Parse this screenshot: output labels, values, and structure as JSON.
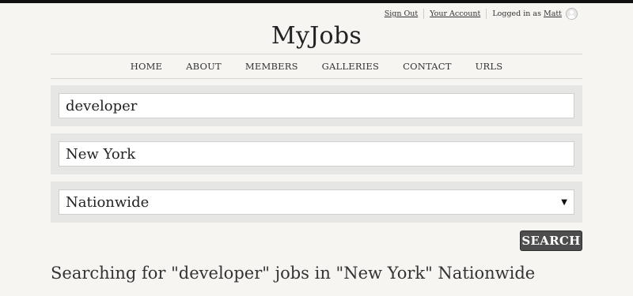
{
  "account": {
    "sign_out": "Sign Out",
    "your_account": "Your Account",
    "logged_in_prefix": "Logged in as",
    "username": "Matt"
  },
  "site": {
    "title": "MyJobs"
  },
  "nav": {
    "items": [
      "HOME",
      "ABOUT",
      "MEMBERS",
      "GALLERIES",
      "CONTACT",
      "URLS"
    ]
  },
  "search": {
    "keyword_value": "developer",
    "location_value": "New York",
    "scope_selected": "Nationwide",
    "button_label": "SEARCH"
  },
  "results": {
    "heading": "Searching for \"developer\" jobs in \"New York\" Nationwide"
  }
}
